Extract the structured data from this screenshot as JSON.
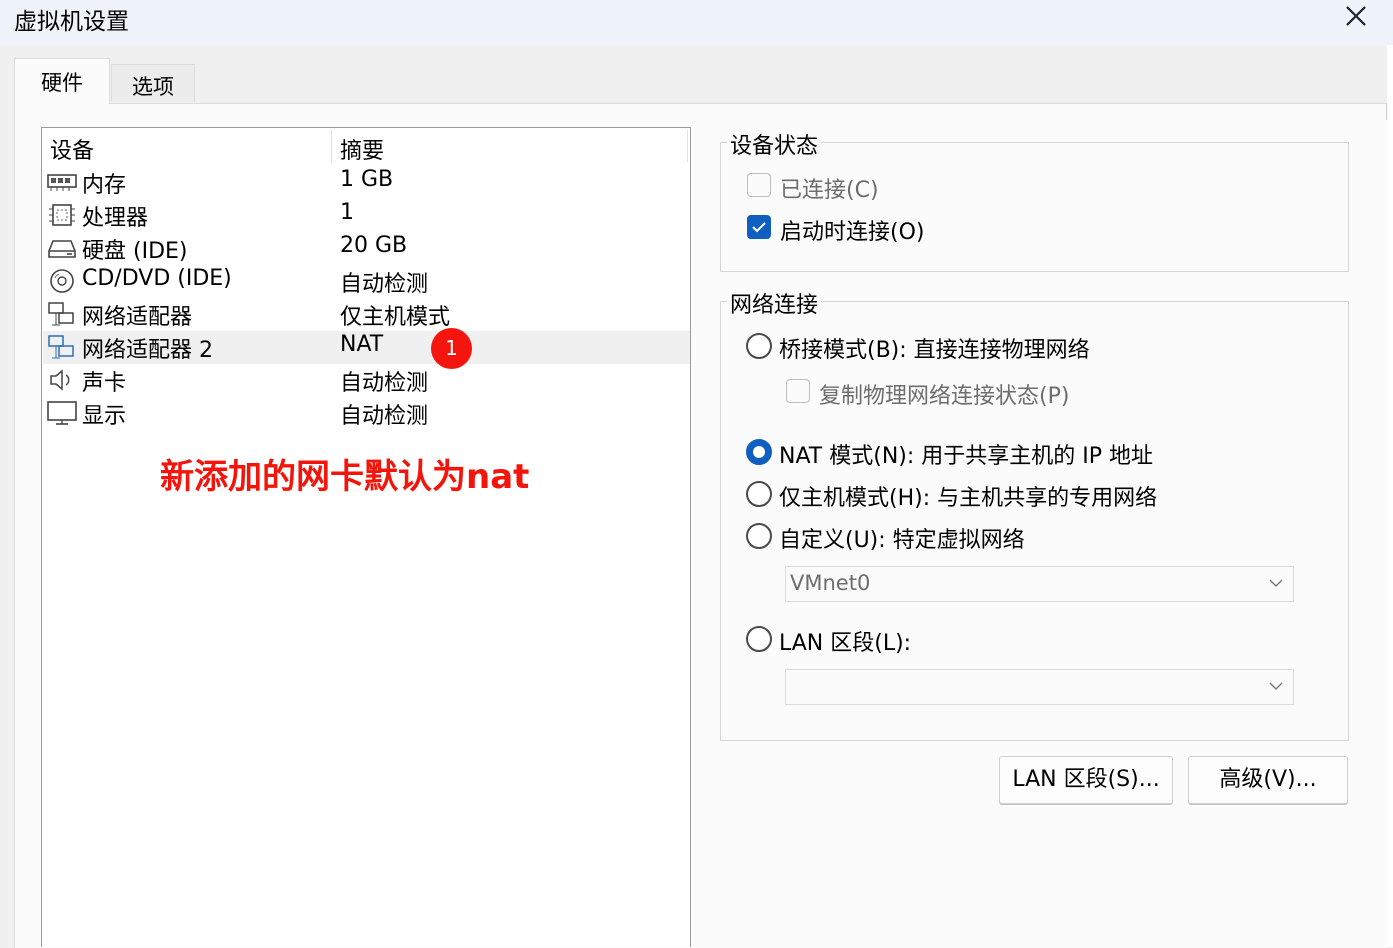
{
  "window": {
    "title": "虚拟机设置"
  },
  "tabs": [
    {
      "label": "硬件",
      "selected": true
    },
    {
      "label": "选项",
      "selected": false
    }
  ],
  "device_table": {
    "columns": [
      "设备",
      "摘要"
    ],
    "rows": [
      {
        "icon": "memory-icon",
        "name": "内存",
        "summary": "1 GB"
      },
      {
        "icon": "processor-icon",
        "name": "处理器",
        "summary": "1"
      },
      {
        "icon": "hard-disk-icon",
        "name": "硬盘 (IDE)",
        "summary": "20 GB"
      },
      {
        "icon": "cd-dvd-icon",
        "name": "CD/DVD (IDE)",
        "summary": "自动检测"
      },
      {
        "icon": "network-adapter-icon",
        "name": "网络适配器",
        "summary": "仅主机模式"
      },
      {
        "icon": "network-adapter-icon",
        "name": "网络适配器 2",
        "summary": "NAT",
        "selected": true
      },
      {
        "icon": "sound-card-icon",
        "name": "声卡",
        "summary": "自动检测"
      },
      {
        "icon": "display-icon",
        "name": "显示",
        "summary": "自动检测"
      }
    ]
  },
  "annotation": {
    "badge": "1",
    "text": "新添加的网卡默认为nat"
  },
  "device_status": {
    "title": "设备状态",
    "connected": {
      "label": "已连接(C)",
      "checked": false,
      "disabled": true
    },
    "connect_at_power_on": {
      "label": "启动时连接(O)",
      "checked": true,
      "disabled": false
    }
  },
  "network_connection": {
    "title": "网络连接",
    "bridged": {
      "label": "桥接模式(B): 直接连接物理网络",
      "checked": false
    },
    "replicate": {
      "label": "复制物理网络连接状态(P)",
      "checked": false,
      "disabled": true
    },
    "nat": {
      "label": "NAT 模式(N): 用于共享主机的 IP 地址",
      "checked": true
    },
    "host_only": {
      "label": "仅主机模式(H): 与主机共享的专用网络",
      "checked": false
    },
    "custom": {
      "label": "自定义(U): 特定虚拟网络",
      "checked": false
    },
    "custom_select_value": "VMnet0",
    "lan_segment": {
      "label": "LAN 区段(L):",
      "checked": false
    },
    "lan_select_value": ""
  },
  "buttons": {
    "lan_segments": "LAN 区段(S)...",
    "advanced": "高级(V)..."
  },
  "colors": {
    "accent": "#0f5fc1",
    "annotation": "#f3150c",
    "selected_row": "#f0f0f0"
  }
}
